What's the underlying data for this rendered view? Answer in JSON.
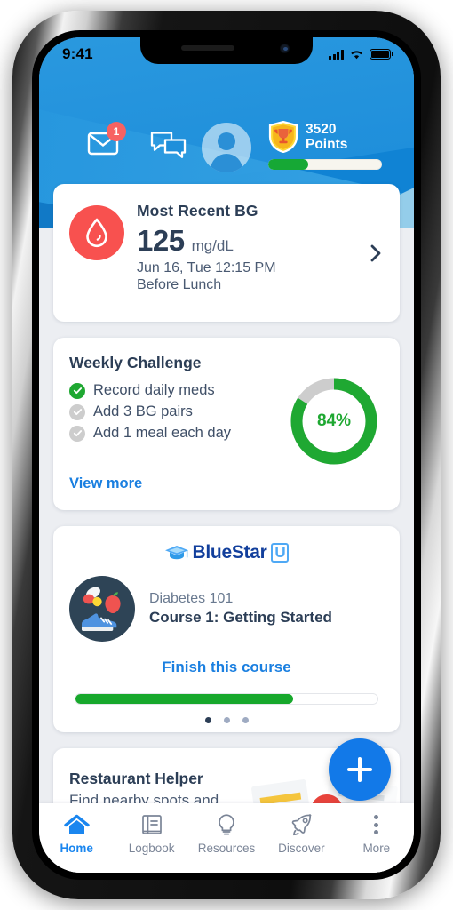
{
  "status_bar": {
    "time": "9:41",
    "signal_icon": "cellular-signal-icon",
    "wifi_icon": "wifi-icon",
    "battery_icon": "battery-icon"
  },
  "header": {
    "mail_icon": "mail-icon",
    "mail_badge_count": "1",
    "chat_icon": "chat-bubbles-icon",
    "avatar_icon": "user-avatar-icon",
    "trophy_icon": "trophy-shield-icon",
    "points_value": "3520",
    "points_label": "Points",
    "points_progress_percent": 35,
    "background_color": "#1083d4"
  },
  "bg_card": {
    "icon": "blood-drop-icon",
    "title": "Most Recent BG",
    "value": "125",
    "unit": "mg/dL",
    "datetime": "Jun 16, Tue 12:15 PM",
    "context": "Before Lunch",
    "chevron_icon": "chevron-right-icon",
    "accent_color": "#f8514f"
  },
  "challenge_card": {
    "title": "Weekly Challenge",
    "items": [
      {
        "label": "Record daily meds",
        "done": true
      },
      {
        "label": "Add 3 BG pairs",
        "done": false
      },
      {
        "label": "Add 1 meal each day",
        "done": false
      }
    ],
    "link_label": "View more",
    "progress_label": "84%",
    "progress_percent": 84,
    "progress_color": "#1fa832",
    "track_color": "#cdcdcd"
  },
  "course_card": {
    "brand_primary": "BlueStar",
    "brand_suffix": "U",
    "cap_icon": "graduation-cap-icon",
    "thumbnail_icon": "health-lifestyle-icon",
    "subtitle": "Diabetes 101",
    "name": "Course 1: Getting Started",
    "cta_label": "Finish this course",
    "progress_percent": 72,
    "progress_color": "#17a82c",
    "dots": [
      {
        "active": true
      },
      {
        "active": false
      },
      {
        "active": false
      }
    ]
  },
  "restaurant_card": {
    "title": "Restaurant Helper",
    "subtitle": "Find nearby spots and",
    "art_icon": "map-with-pin-icon"
  },
  "fab": {
    "icon": "plus-icon",
    "color": "#1279e8"
  },
  "bottom_nav": {
    "items": [
      {
        "label": "Home",
        "icon": "home-icon",
        "active": true
      },
      {
        "label": "Logbook",
        "icon": "book-icon",
        "active": false
      },
      {
        "label": "Resources",
        "icon": "lightbulb-icon",
        "active": false
      },
      {
        "label": "Discover",
        "icon": "rocket-icon",
        "active": false
      },
      {
        "label": "More",
        "icon": "more-dots-icon",
        "active": false
      }
    ],
    "active_color": "#1a86ef",
    "inactive_color": "#7b8597"
  }
}
